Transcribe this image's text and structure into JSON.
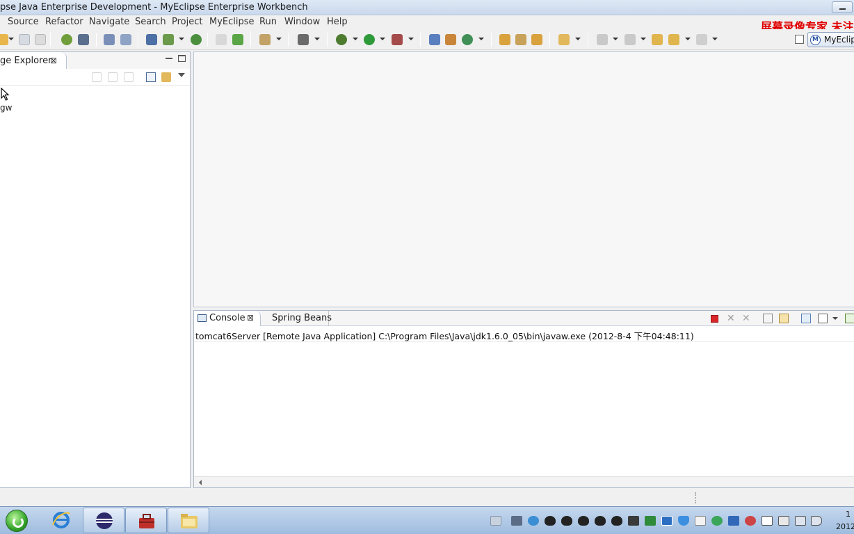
{
  "window": {
    "title": "pse Java Enterprise Development - MyEclipse Enterprise Workbench"
  },
  "menu": {
    "items": [
      "Source",
      "Refactor",
      "Navigate",
      "Search",
      "Project",
      "MyEclipse",
      "Run",
      "Window",
      "Help"
    ]
  },
  "watermark": "屏幕录像专家 未注",
  "perspective": {
    "label": "MyEclipse",
    "icon_letter": "M"
  },
  "left_view": {
    "tab_label": "ge Explorer",
    "close_glyph": "⊠",
    "tree_items": [
      "gw"
    ]
  },
  "console_view": {
    "tabs": [
      {
        "label": "Console",
        "icon": "console-icon",
        "active": true
      },
      {
        "label": "Spring Beans",
        "icon": "none",
        "active": false
      }
    ],
    "process_line": "tomcat6Server [Remote Java Application] C:\\Program Files\\Java\\jdk1.6.0_05\\bin\\javaw.exe (2012-8-4 下午04:48:11)"
  },
  "taskbar": {
    "apps": [
      "internet-explorer",
      "eclipse",
      "toolbox",
      "file-explorer"
    ],
    "clock_time": "1",
    "clock_date": "2012"
  },
  "colors": {
    "stop_red": "#d9262b",
    "accent_blue": "#2c57a4",
    "watermark_red": "#e00000"
  }
}
